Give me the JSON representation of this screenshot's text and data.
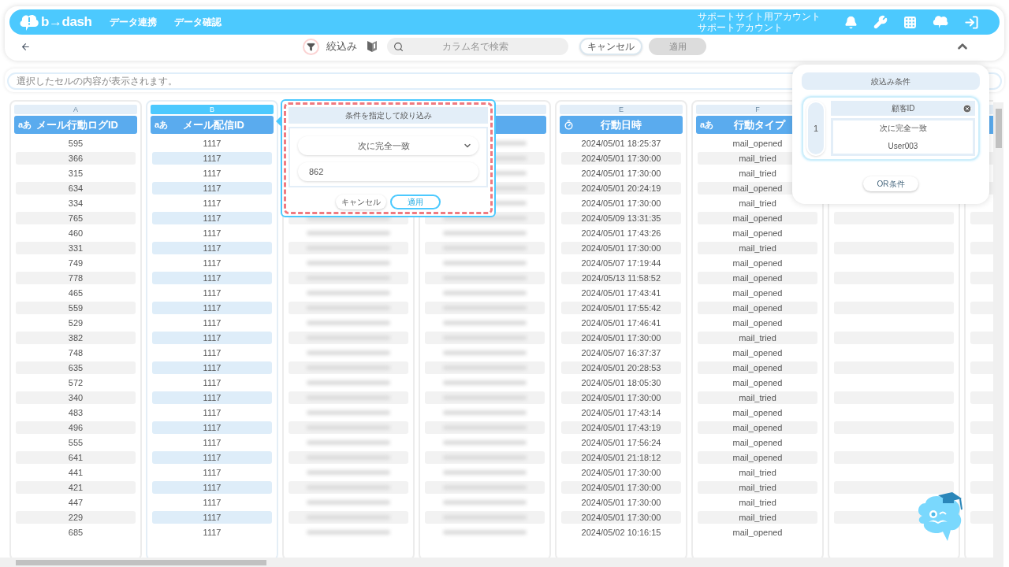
{
  "nav": {
    "logo": "b→dash",
    "menu": [
      "データ連携",
      "データ確認"
    ],
    "account": [
      "サポートサイト用アカウント",
      "サポートアカウント"
    ]
  },
  "toolbar": {
    "filter_label": "絞込み",
    "search": {
      "placeholder": "カラム名で検索"
    },
    "cancel": "キャンセル",
    "apply": {
      "label": "適用",
      "disabled": true
    }
  },
  "cell_display": {
    "placeholder": "選択したセルの内容が表示されます。"
  },
  "columns": [
    {
      "letter": "A",
      "title": "メール行動ログID",
      "type_label": "aあ",
      "kind": "text",
      "selected": false,
      "cells": [
        "595",
        "366",
        "315",
        "634",
        "334",
        "765",
        "460",
        "331",
        "749",
        "778",
        "465",
        "559",
        "529",
        "382",
        "748",
        "635",
        "572",
        "340",
        "483",
        "496",
        "555",
        "641",
        "441",
        "421",
        "447",
        "229",
        "685"
      ]
    },
    {
      "letter": "B",
      "title": "メール配信ID",
      "type_label": "aあ",
      "kind": "text",
      "selected": true,
      "cells": [
        "1117",
        "1117",
        "1117",
        "1117",
        "1117",
        "1117",
        "1117",
        "1117",
        "1117",
        "1117",
        "1117",
        "1117",
        "1117",
        "1117",
        "1117",
        "1117",
        "1117",
        "1117",
        "1117",
        "1117",
        "1117",
        "1117",
        "1117",
        "1117",
        "1117",
        "1117",
        "1117"
      ]
    },
    {
      "kind": "blurred"
    },
    {
      "kind": "blurred",
      "selected": false
    },
    {
      "letter": "E",
      "title": "行動日時",
      "kind": "datetime",
      "selected": false,
      "cells": [
        "2024/05/01 18:25:37",
        "2024/05/01 17:30:00",
        "2024/05/01 17:30:00",
        "2024/05/01 20:24:19",
        "2024/05/01 17:30:00",
        "2024/05/09 13:31:35",
        "2024/05/01 17:43:26",
        "2024/05/01 17:30:00",
        "2024/05/07 17:19:44",
        "2024/05/13 11:58:52",
        "2024/05/01 17:43:41",
        "2024/05/01 17:55:42",
        "2024/05/01 17:46:41",
        "2024/05/01 17:30:00",
        "2024/05/07 16:37:37",
        "2024/05/01 20:28:53",
        "2024/05/01 18:05:30",
        "2024/05/01 17:30:00",
        "2024/05/01 17:43:14",
        "2024/05/01 17:43:19",
        "2024/05/01 17:56:24",
        "2024/05/01 21:18:12",
        "2024/05/01 17:30:00",
        "2024/05/01 17:30:00",
        "2024/05/01 17:30:00",
        "2024/05/01 17:30:00",
        "2024/05/02 10:16:15"
      ]
    },
    {
      "letter": "F",
      "title": "行動タイプ",
      "type_label": "aあ",
      "kind": "text",
      "selected": false,
      "cells": [
        "mail_opened",
        "mail_tried",
        "mail_tried",
        "mail_opened",
        "mail_tried",
        "mail_opened",
        "mail_opened",
        "mail_tried",
        "mail_opened",
        "mail_opened",
        "mail_opened",
        "mail_opened",
        "mail_opened",
        "mail_tried",
        "mail_opened",
        "mail_opened",
        "mail_opened",
        "mail_tried",
        "mail_opened",
        "mail_opened",
        "mail_opened",
        "mail_opened",
        "mail_tried",
        "mail_tried",
        "mail_tried",
        "mail_tried",
        "mail_opened"
      ]
    },
    {
      "kind": "empty"
    },
    {
      "kind": "empty",
      "selected": false
    }
  ],
  "filter_popup": {
    "title": "条件を指定して絞り込み",
    "condition": "次に完全一致",
    "value": "862",
    "cancel": "キャンセル",
    "apply": "適用"
  },
  "conditions_panel": {
    "title": "絞込み条件",
    "groups": [
      {
        "number": "1",
        "field": "顧客ID",
        "condition": "次に完全一致",
        "value": "User003"
      }
    ],
    "or_button": "OR条件"
  }
}
